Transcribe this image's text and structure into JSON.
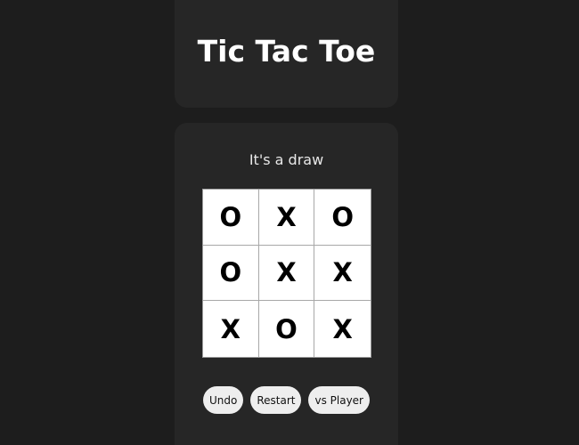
{
  "header": {
    "title": "Tic Tac Toe"
  },
  "game": {
    "status": "It's a draw",
    "board": [
      [
        "O",
        "X",
        "O"
      ],
      [
        "O",
        "X",
        "X"
      ],
      [
        "X",
        "O",
        "X"
      ]
    ]
  },
  "controls": {
    "undo_label": "Undo",
    "restart_label": "Restart",
    "mode_label": "vs Player"
  },
  "colors": {
    "background": "#1d1d1d",
    "card": "#262626",
    "board": "#ffffff",
    "mark": "#000000",
    "button": "#eeeeee"
  }
}
